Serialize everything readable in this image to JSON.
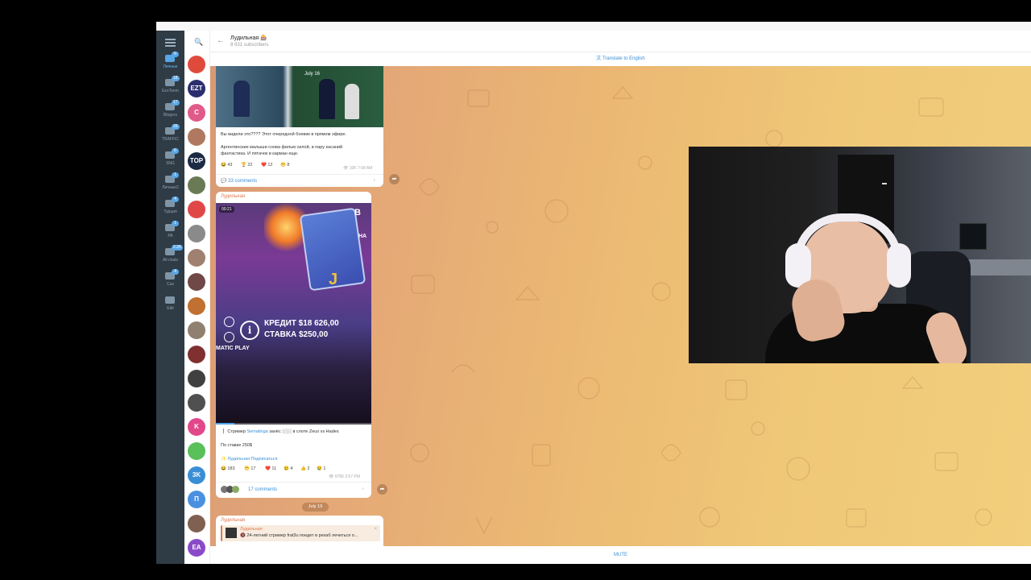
{
  "folders": [
    {
      "label": "Личные",
      "badge": "6",
      "active": true
    },
    {
      "label": "EzoTeem",
      "badge": "18",
      "active": false
    },
    {
      "label": "Blogers",
      "badge": "17",
      "active": false
    },
    {
      "label": "TRAFFIC",
      "badge": "26",
      "active": false
    },
    {
      "label": "SNG",
      "badge": "6",
      "active": false
    },
    {
      "label": "Личные2",
      "badge": "1",
      "active": false
    },
    {
      "label": "Турция",
      "badge": "4",
      "active": false
    },
    {
      "label": "PA",
      "badge": "1",
      "active": false
    },
    {
      "label": "All chats",
      "badge": "2.2K",
      "active": false
    },
    {
      "label": "Cas",
      "badge": "4",
      "active": false
    },
    {
      "label": "Edit",
      "badge": "",
      "active": false
    }
  ],
  "chat_avatars": [
    {
      "text": "",
      "color": "#e04a3a"
    },
    {
      "text": "EZT",
      "color": "#2b2f6e"
    },
    {
      "text": "C",
      "color": "#e05a8a"
    },
    {
      "text": "",
      "color": "#b07860"
    },
    {
      "text": "TOP",
      "color": "#1c2a44"
    },
    {
      "text": "",
      "color": "#6a7a55"
    },
    {
      "text": "",
      "color": "#e04848"
    },
    {
      "text": "",
      "color": "#8a8a8a"
    },
    {
      "text": "",
      "color": "#a08070"
    },
    {
      "text": "",
      "color": "#704848"
    },
    {
      "text": "",
      "color": "#c07030"
    },
    {
      "text": "",
      "color": "#908070"
    },
    {
      "text": "",
      "color": "#803030"
    },
    {
      "text": "",
      "color": "#404040"
    },
    {
      "text": "",
      "color": "#505050"
    },
    {
      "text": "K",
      "color": "#e0488a"
    },
    {
      "text": "",
      "color": "#5ac05a"
    },
    {
      "text": "3K",
      "color": "#3a8ed6"
    },
    {
      "text": "П",
      "color": "#4a90e0"
    },
    {
      "text": "",
      "color": "#806050"
    },
    {
      "text": "EA",
      "color": "#8a4ac8"
    }
  ],
  "header": {
    "title": "Лудильная 🎰",
    "subscribers": "8 931 subscribers",
    "back_icon": "←",
    "search_icon": "🔍"
  },
  "translate_label": "Translate to English",
  "mute_label": "MUTE",
  "post1": {
    "image_date": "July 16",
    "text_line1": "Вы видели это???? Этот очередной боевик в прямом эфире.",
    "text_line2": "Аргентинские малыши снова фильм силой, в пару касаний",
    "text_line3": "фантастика. И пятачок в карман еще.",
    "reactions": [
      "😂 43",
      "🏆 22",
      "❤️ 12",
      "😁 8"
    ],
    "views": "10K",
    "time": "7:08 AM",
    "comments": "33 comments"
  },
  "post2": {
    "channel": "Лудильная",
    "video_time": "00:21",
    "video_credit": "КРЕДИТ $18 626,00",
    "video_bet": "СТАВКА $250,00",
    "video_provider": "MATIC PLAY",
    "video_letter_b": "B",
    "video_letter_na": "НА",
    "video_letter_j": "J",
    "progress": 0.12,
    "line1_prefix": "❗ Стример",
    "line1_link": "Sematinga",
    "line1_suffix": "занёс ░░░ в слоте Zeus vs Hades",
    "line2": "По ставке 250$",
    "sign": "✨ Лудильная  Подписаться",
    "reactions": [
      "😂 183",
      "😁 17",
      "❤️ 11",
      "😢 4",
      "👍 2",
      "😢 1"
    ],
    "views": "9786",
    "time": "2:57 PM",
    "comments": "17 comments"
  },
  "date_pill": "July 19",
  "post3": {
    "channel": "Лудильная",
    "reply_title": "Лудильная",
    "reply_text": "🔞 24-летний стример frat3u поедет в рехаб лечиться о...",
    "close_icon": "×"
  },
  "forward_icon": "➦"
}
